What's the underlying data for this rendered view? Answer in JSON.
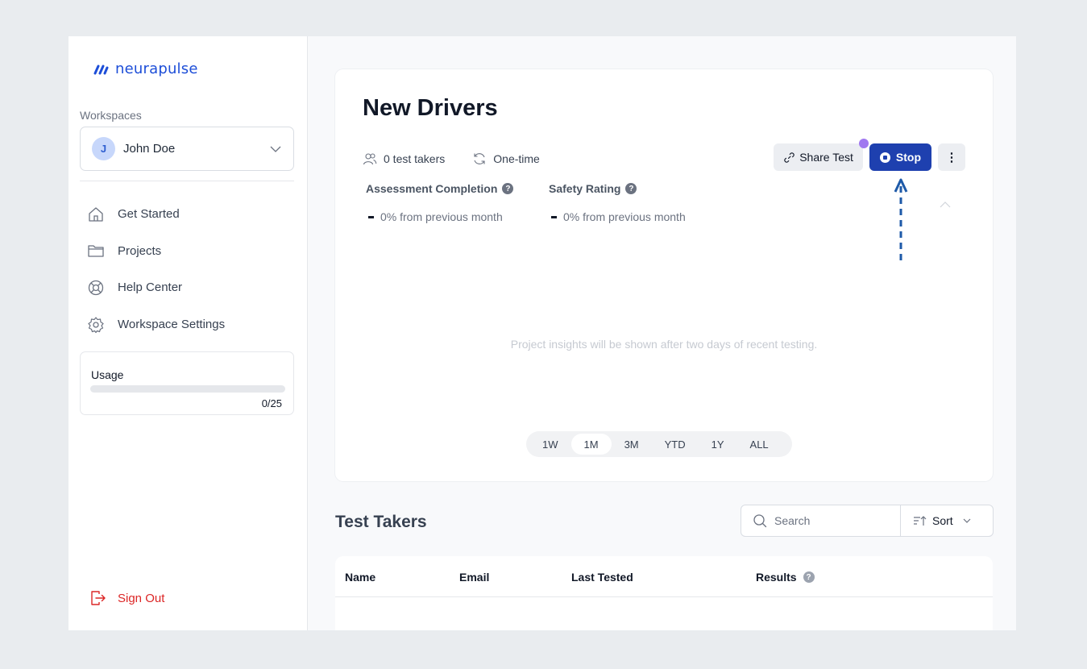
{
  "brand": {
    "name": "neurapulse",
    "color": "#1d4ed8"
  },
  "sidebar": {
    "workspaces_label": "Workspaces",
    "workspace": {
      "initial": "J",
      "name": "John Doe"
    },
    "nav": [
      {
        "label": "Get Started",
        "icon": "home-icon"
      },
      {
        "label": "Projects",
        "icon": "folder-icon"
      },
      {
        "label": "Help Center",
        "icon": "lifebuoy-icon"
      },
      {
        "label": "Workspace Settings",
        "icon": "gear-icon"
      }
    ],
    "usage": {
      "title": "Usage",
      "count": "0/25",
      "fraction": 0
    },
    "sign_out": "Sign Out"
  },
  "project": {
    "title": "New Drivers",
    "takers": "0 test takers",
    "frequency": "One-time",
    "share_label": "Share Test",
    "stop_label": "Stop",
    "more_label": "⋮",
    "metrics": [
      {
        "label": "Assessment Completion",
        "sub": "0% from previous month"
      },
      {
        "label": "Safety Rating",
        "sub": "0% from previous month"
      }
    ],
    "empty_message": "Project insights will be shown after two days of recent testing.",
    "ranges": [
      "1W",
      "1M",
      "3M",
      "YTD",
      "1Y",
      "ALL"
    ],
    "active_range": "1M"
  },
  "test_takers": {
    "title": "Test Takers",
    "search_placeholder": "Search",
    "sort_label": "Sort",
    "columns": [
      "Name",
      "Email",
      "Last Tested",
      "Results"
    ]
  },
  "colors": {
    "primary": "#1e40af",
    "danger": "#dc2626",
    "notification": "#a078f0"
  }
}
